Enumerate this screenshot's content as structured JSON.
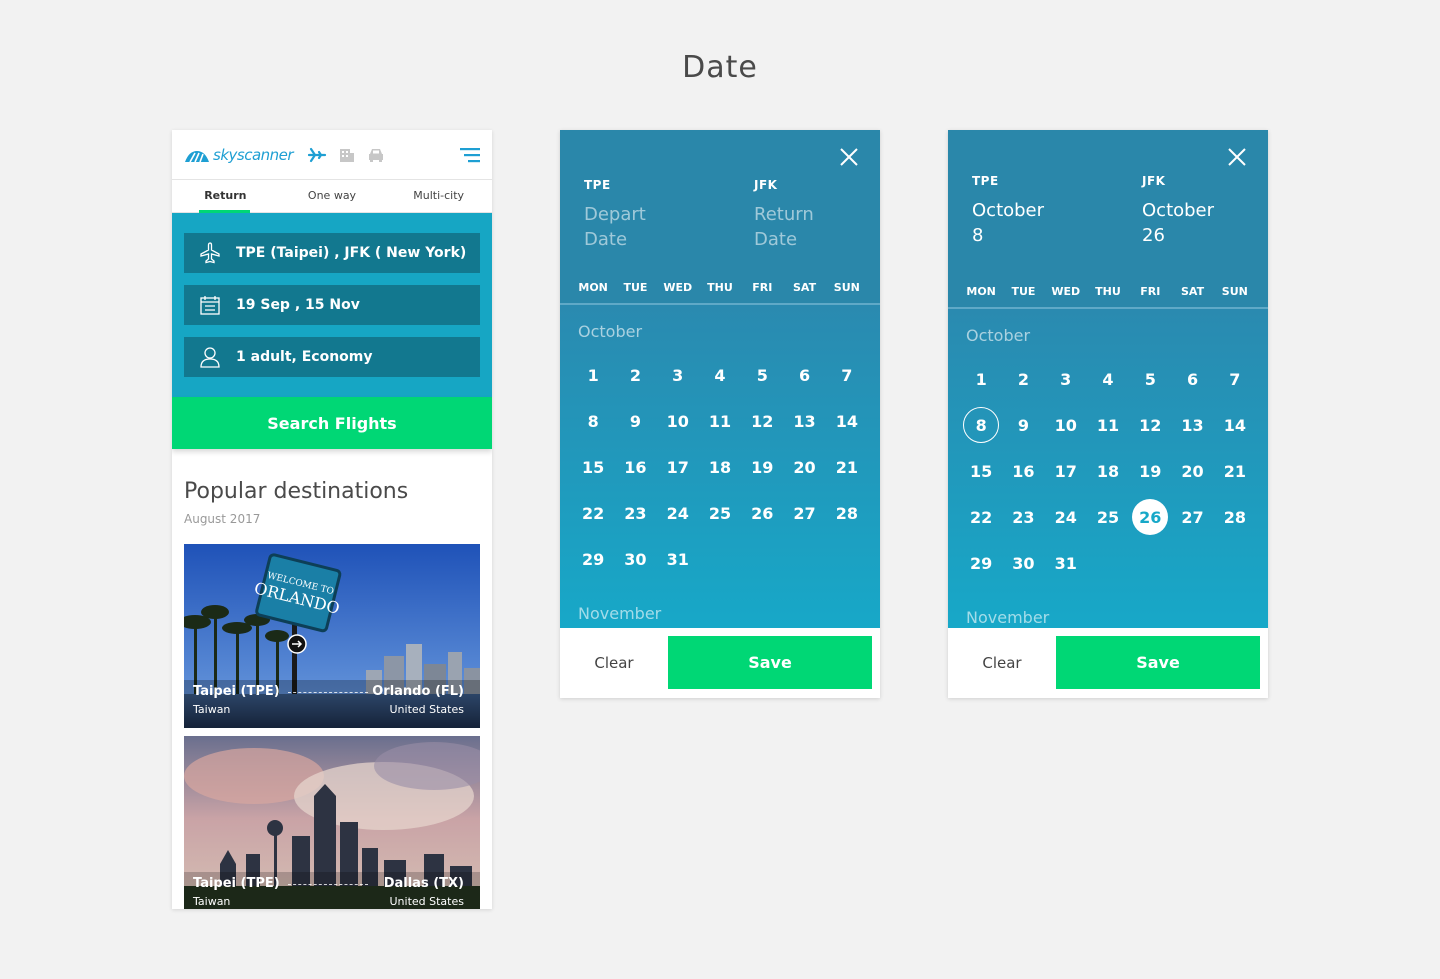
{
  "page_title": "Date",
  "phone": {
    "brand": "skyscanner",
    "tabs": [
      {
        "label": "Return",
        "active": true
      },
      {
        "label": "One way",
        "active": false
      },
      {
        "label": "Multi-city",
        "active": false
      }
    ],
    "route_field": "TPE (Taipei) ,  JFK ( New York)",
    "date_field": "19 Sep ,  15 Nov",
    "passenger_field": "1 adult, Economy",
    "search_button": "Search Flights",
    "popular_title": "Popular destinations",
    "popular_date": "August 2017",
    "destinations": [
      {
        "from": "Taipei  (TPE)",
        "from_country": "Taiwan",
        "to": "Orlando (FL)",
        "to_country": "United States"
      },
      {
        "from": "Taipei  (TPE)",
        "from_country": "Taiwan",
        "to": "Dallas (TX)",
        "to_country": "United States"
      }
    ]
  },
  "calendar_empty": {
    "depart_code": "TPE",
    "depart_label_1": "Depart",
    "depart_label_2": "Date",
    "return_code": "JFK",
    "return_label_1": "Return",
    "return_label_2": "Date",
    "month": "October",
    "next_month": "November",
    "clear": "Clear",
    "save": "Save"
  },
  "calendar_selected": {
    "depart_code": "TPE",
    "depart_label_1": "October",
    "depart_label_2": "8",
    "return_code": "JFK",
    "return_label_1": "October",
    "return_label_2": "26",
    "month": "October",
    "next_month": "November",
    "clear": "Clear",
    "save": "Save",
    "depart_day": 8,
    "return_day": 26
  },
  "weekdays": [
    "MON",
    "TUE",
    "WED",
    "THU",
    "FRI",
    "SAT",
    "SUN"
  ],
  "days": [
    1,
    2,
    3,
    4,
    5,
    6,
    7,
    8,
    9,
    10,
    11,
    12,
    13,
    14,
    15,
    16,
    17,
    18,
    19,
    20,
    21,
    22,
    23,
    24,
    25,
    26,
    27,
    28,
    29,
    30,
    31
  ],
  "colors": {
    "accent": "#00d775",
    "header": "#2a87aa",
    "panel": "#16a6c4",
    "field": "#12788f"
  }
}
